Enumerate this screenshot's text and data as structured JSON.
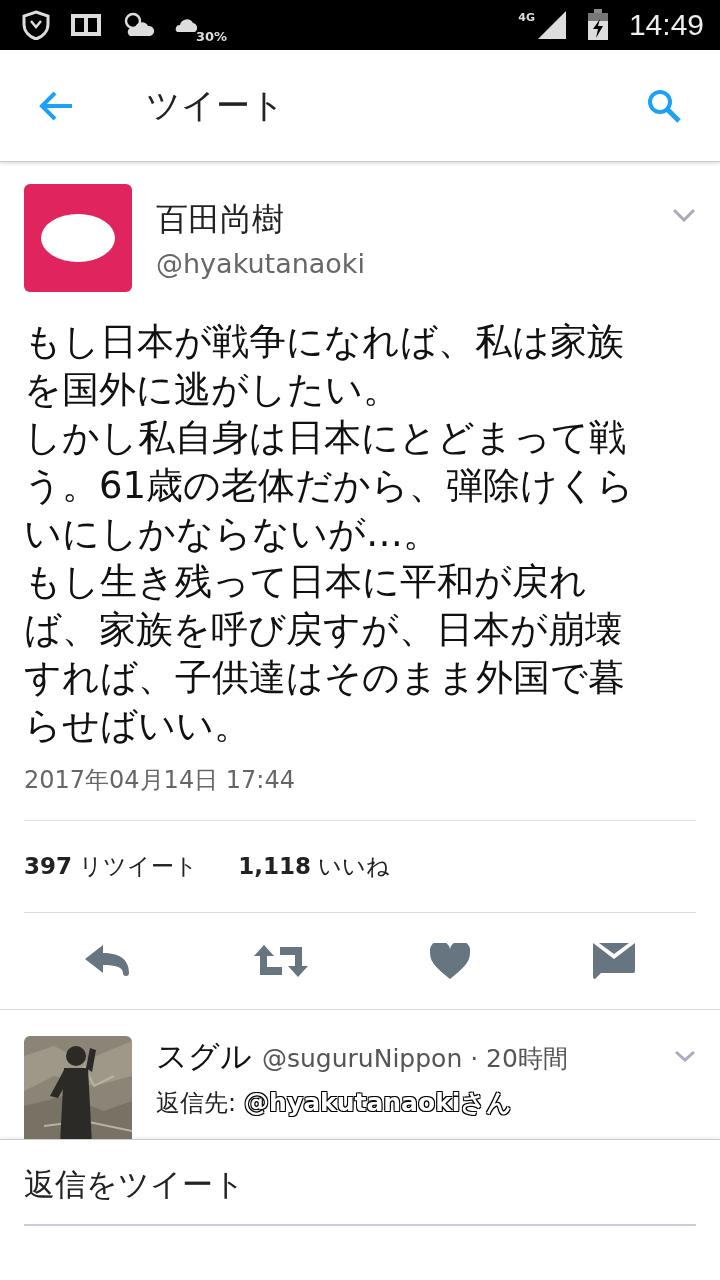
{
  "status_bar": {
    "weather_percent": "30%",
    "network": "4G",
    "time": "14:49"
  },
  "header": {
    "title": "ツイート"
  },
  "tweet": {
    "display_name": "百田尚樹",
    "handle": "@hyakutanaoki",
    "paragraphs": [
      "もし日本が戦争になれば、私は家族を国外に逃がしたい。",
      "しかし私自身は日本にとどまって戦う。61歳の老体だから、弾除けくらいにしかならないが…。",
      "もし生き残って日本に平和が戻れば、家族を呼び戻すが、日本が崩壊すれば、子供達はそのまま外国で暮らせばいい。"
    ],
    "timestamp": "2017年04月14日 17:44",
    "retweets": "**397** リツイート",
    "likes": "**1,118** いいね"
  },
  "reply": {
    "name": "スグル",
    "meta": "@suguruNippon · 20時間",
    "reply_to_label": "返信先:",
    "reply_to_user": "@hyakutanaokiさん"
  },
  "reply_bar": {
    "placeholder": "返信をツイート"
  }
}
